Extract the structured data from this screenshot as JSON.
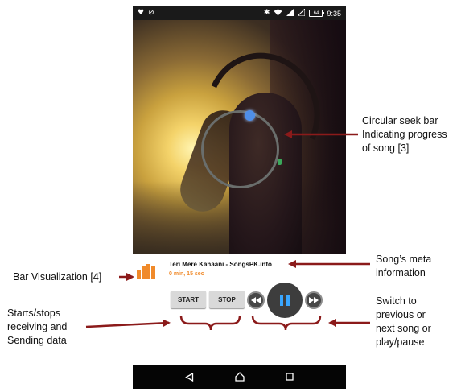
{
  "status_bar": {
    "left_icons": [
      "heart-icon",
      "circle-slash-icon"
    ],
    "right_icons": [
      "bluetooth-icon",
      "wifi-icon",
      "signal-icon",
      "no-sim-icon",
      "battery-icon"
    ],
    "battery": "64",
    "time": "9:35"
  },
  "seek": {
    "progress": 0.02
  },
  "meta": {
    "title": "Teri Mere Kahaani - SongsPK.info",
    "time": "0 min, 15 sec",
    "visualizer_levels": [
      0.6,
      0.9,
      1.0,
      0.85
    ],
    "accent_color": "#f08a2a"
  },
  "controls": {
    "start_label": "START",
    "stop_label": "STOP",
    "prev_icon": "rewind-icon",
    "play_icon": "pause-icon",
    "next_icon": "fast-forward-icon",
    "play_icon_color": "#39a6ff"
  },
  "nav": {
    "icons": [
      "back-icon",
      "home-icon",
      "recents-icon"
    ]
  },
  "annotations": {
    "seek": [
      "Circular seek bar",
      "Indicating progress",
      "of song [3]"
    ],
    "meta": [
      "Song’s meta",
      "information"
    ],
    "visualizer": [
      "Bar Visualization [4]"
    ],
    "startstop": [
      "Starts/stops",
      "receiving and",
      "Sending data"
    ],
    "switch": [
      "Switch to",
      "previous or",
      "next song or",
      "play/pause"
    ],
    "arrow_color": "#8b1a1a"
  }
}
